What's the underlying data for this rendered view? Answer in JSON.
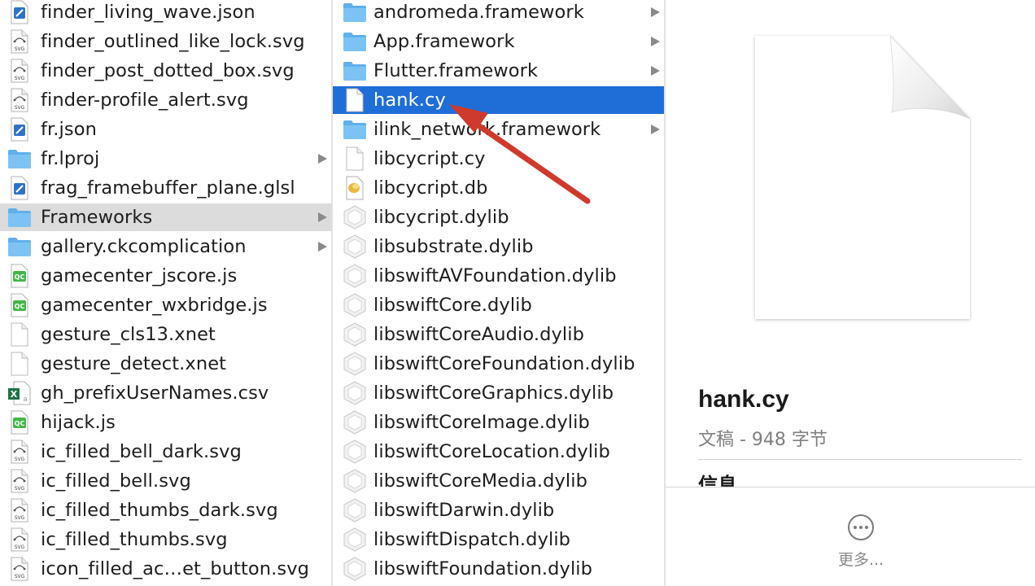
{
  "column1": {
    "items": [
      {
        "label": "finder_living_wave.json",
        "icon": "json-file-icon",
        "folder": false
      },
      {
        "label": "finder_outlined_like_lock.svg",
        "icon": "svg-file-icon",
        "folder": false
      },
      {
        "label": "finder_post_dotted_box.svg",
        "icon": "svg-file-icon",
        "folder": false
      },
      {
        "label": "finder-profile_alert.svg",
        "icon": "svg-file-icon",
        "folder": false
      },
      {
        "label": "fr.json",
        "icon": "json-file-icon",
        "folder": false
      },
      {
        "label": "fr.lproj",
        "icon": "folder-icon",
        "folder": true
      },
      {
        "label": "frag_framebuffer_plane.glsl",
        "icon": "glsl-file-icon",
        "folder": false
      },
      {
        "label": "Frameworks",
        "icon": "folder-icon",
        "folder": true,
        "highlighted": true
      },
      {
        "label": "gallery.ckcomplication",
        "icon": "folder-icon",
        "folder": true
      },
      {
        "label": "gamecenter_jscore.js",
        "icon": "js-file-icon",
        "folder": false
      },
      {
        "label": "gamecenter_wxbridge.js",
        "icon": "js-file-icon",
        "folder": false
      },
      {
        "label": "gesture_cls13.xnet",
        "icon": "blank-file-icon",
        "folder": false
      },
      {
        "label": "gesture_detect.xnet",
        "icon": "blank-file-icon",
        "folder": false
      },
      {
        "label": "gh_prefixUserNames.csv",
        "icon": "excel-file-icon",
        "folder": false
      },
      {
        "label": "hijack.js",
        "icon": "js-file-icon",
        "folder": false
      },
      {
        "label": "ic_filled_bell_dark.svg",
        "icon": "svg-file-icon",
        "folder": false
      },
      {
        "label": "ic_filled_bell.svg",
        "icon": "svg-file-icon",
        "folder": false
      },
      {
        "label": "ic_filled_thumbs_dark.svg",
        "icon": "svg-file-icon",
        "folder": false
      },
      {
        "label": "ic_filled_thumbs.svg",
        "icon": "svg-file-icon",
        "folder": false
      },
      {
        "label": "icon_filled_ac…et_button.svg",
        "icon": "svg-file-icon",
        "folder": false
      }
    ]
  },
  "column2": {
    "items": [
      {
        "label": "andromeda.framework",
        "icon": "folder-icon",
        "folder": true
      },
      {
        "label": "App.framework",
        "icon": "folder-icon",
        "folder": true
      },
      {
        "label": "Flutter.framework",
        "icon": "folder-icon",
        "folder": true
      },
      {
        "label": "hank.cy",
        "icon": "blank-file-icon",
        "folder": false,
        "selected": true
      },
      {
        "label": "ilink_network.framework",
        "icon": "folder-icon",
        "folder": true
      },
      {
        "label": "libcycript.cy",
        "icon": "blank-file-icon",
        "folder": false
      },
      {
        "label": "libcycript.db",
        "icon": "db-file-icon",
        "folder": false
      },
      {
        "label": "libcycript.dylib",
        "icon": "dylib-file-icon",
        "folder": false
      },
      {
        "label": "libsubstrate.dylib",
        "icon": "dylib-file-icon",
        "folder": false
      },
      {
        "label": "libswiftAVFoundation.dylib",
        "icon": "dylib-file-icon",
        "folder": false
      },
      {
        "label": "libswiftCore.dylib",
        "icon": "dylib-file-icon",
        "folder": false
      },
      {
        "label": "libswiftCoreAudio.dylib",
        "icon": "dylib-file-icon",
        "folder": false
      },
      {
        "label": "libswiftCoreFoundation.dylib",
        "icon": "dylib-file-icon",
        "folder": false
      },
      {
        "label": "libswiftCoreGraphics.dylib",
        "icon": "dylib-file-icon",
        "folder": false
      },
      {
        "label": "libswiftCoreImage.dylib",
        "icon": "dylib-file-icon",
        "folder": false
      },
      {
        "label": "libswiftCoreLocation.dylib",
        "icon": "dylib-file-icon",
        "folder": false
      },
      {
        "label": "libswiftCoreMedia.dylib",
        "icon": "dylib-file-icon",
        "folder": false
      },
      {
        "label": "libswiftDarwin.dylib",
        "icon": "dylib-file-icon",
        "folder": false
      },
      {
        "label": "libswiftDispatch.dylib",
        "icon": "dylib-file-icon",
        "folder": false
      },
      {
        "label": "libswiftFoundation.dylib",
        "icon": "dylib-file-icon",
        "folder": false
      }
    ]
  },
  "preview": {
    "filename": "hank.cy",
    "kind": "文稿 - 948 字节",
    "info_heading": "信息",
    "more_label": "更多..."
  },
  "colors": {
    "selection": "#1f6ed8",
    "highlight": "#dcdcdc",
    "folder": "#6cb8f0",
    "annotation_arrow": "#cf3a2c"
  }
}
